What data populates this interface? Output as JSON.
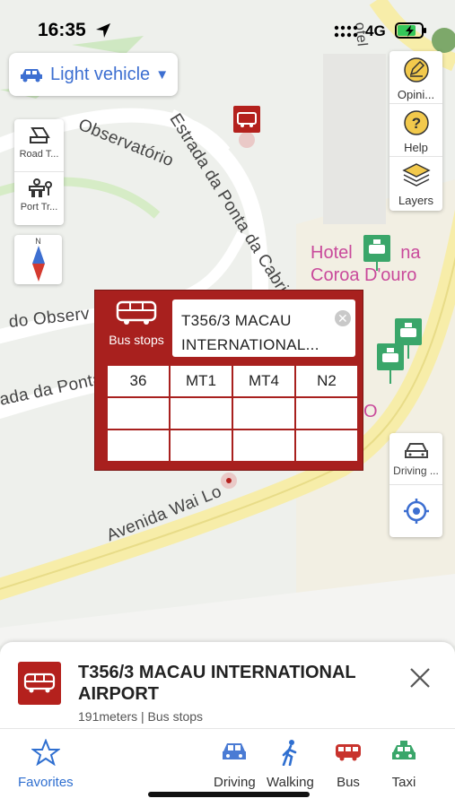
{
  "status_bar": {
    "time": "16:35",
    "network": "4G"
  },
  "vehicle_selector": {
    "label": "Light vehicle",
    "icon": "car-icon",
    "accent": "#3d6fd1"
  },
  "left_tools": [
    {
      "label": "Road T...",
      "icon": "road-tool-icon"
    },
    {
      "label": "Port Tr...",
      "icon": "port-traffic-icon"
    }
  ],
  "compass": {
    "north_label": "N"
  },
  "right_tools": [
    {
      "label": "Opini...",
      "icon": "opinion-icon"
    },
    {
      "label": "Help",
      "icon": "help-icon"
    },
    {
      "label": "Layers",
      "icon": "layers-icon"
    }
  ],
  "driving_tool": {
    "label": "Driving ...",
    "icon": "car-outline-icon"
  },
  "map_labels": {
    "road1": "Estrada da Ponta da Cabrita",
    "road2": "Observatório",
    "road3": "do Observ",
    "road4": "ada da Ponta",
    "road5": "Avenida Wai Lo",
    "hotel": "Hotel Fina Coroa D'ouro",
    "hotel_line1": "Hotel",
    "hotel_line2": "na",
    "hotel_line3": "Coroa D'ouro",
    "partial_o": "O",
    "partial_top": "otel"
  },
  "popup": {
    "category": "Bus stops",
    "title_line1": "T356/3 MACAU",
    "title_line2": "INTERNATIONAL...",
    "routes": [
      [
        "36",
        "MT1",
        "MT4",
        "N2"
      ],
      [
        "",
        "",
        "",
        ""
      ],
      [
        "",
        "",
        "",
        ""
      ]
    ]
  },
  "bottom_sheet": {
    "title": "T356/3 MACAU INTERNATIONAL AIRPORT",
    "subtitle": "191meters | Bus stops"
  },
  "bottom_nav": [
    {
      "label": "Favorites",
      "icon": "star-icon"
    },
    {
      "label": "Driving",
      "icon": "car-icon"
    },
    {
      "label": "Walking",
      "icon": "walking-icon"
    },
    {
      "label": "Bus",
      "icon": "bus-icon"
    },
    {
      "label": "Taxi",
      "icon": "taxi-icon"
    }
  ],
  "colors": {
    "bus_red": "#b4211d",
    "taxi_green": "#3aa66a",
    "link_blue": "#2f6fd0",
    "hotel_pink": "#c94a9b"
  }
}
